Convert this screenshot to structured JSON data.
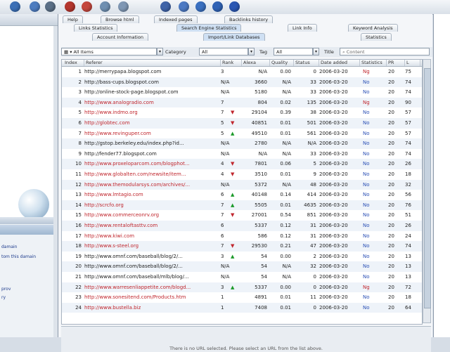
{
  "toolbar": {
    "buttons": [
      {
        "name": "refresh-icon",
        "color": "#3b6fb6"
      },
      {
        "name": "user-icon",
        "color": "#4d7cc0"
      },
      {
        "name": "settings-icon",
        "color": "#5b6f86"
      },
      {
        "name": "stop-icon",
        "color": "#b4362e"
      },
      {
        "name": "record-icon",
        "color": "#c4473d"
      },
      {
        "name": "globe-icon",
        "color": "#6f8fb1"
      },
      {
        "name": "page-icon",
        "color": "#7f97b4"
      },
      {
        "name": "clock-icon",
        "color": "#3f63a8"
      },
      {
        "name": "edit-icon",
        "color": "#4c79c3"
      },
      {
        "name": "check-icon",
        "color": "#3a70c0"
      },
      {
        "name": "save-icon",
        "color": "#2f62b5"
      },
      {
        "name": "help-icon",
        "color": "#2b57b3"
      }
    ]
  },
  "tabs_row1": [
    "Help",
    "Browse html",
    "Indexed pages",
    "Backlinks history"
  ],
  "tabs_row2": [
    "Links Statistics",
    "Search Engine Statistics",
    "Link Info",
    "Keyword Analysis"
  ],
  "tabs_row3": [
    "Account Information",
    "Import/Link Databases",
    "Statistics"
  ],
  "filter": {
    "category_label": "Category",
    "tag_label": "Tag",
    "title_label": "Title",
    "all_items": "All Items",
    "category_value": "All",
    "tag_value": "All",
    "search_placeholder": "Content"
  },
  "columns": [
    "Index",
    "Referer",
    "Rank",
    "Alexa",
    "Quality",
    "Status",
    "Date added",
    "Statistics",
    "PR",
    "L"
  ],
  "rows": [
    {
      "index": "1",
      "url": "http://merrypapa.blogspot.com",
      "color": "black",
      "rank": "3",
      "trend": "",
      "alexa": "N/A",
      "quality": "0.00",
      "status": "0",
      "date": "2006-03-20",
      "stat": "Ng",
      "pr": "20",
      "l": "75"
    },
    {
      "index": "2",
      "url": "http://bass-cups.blogspot.com",
      "color": "black",
      "rank": "N/A",
      "trend": "",
      "alexa": "3660",
      "quality": "N/A",
      "status": "33",
      "date": "2006-03-20",
      "stat": "No",
      "pr": "20",
      "l": "74"
    },
    {
      "index": "3",
      "url": "http://online-stock-page.blogspot.com",
      "color": "black",
      "rank": "N/A",
      "trend": "",
      "alexa": "5180",
      "quality": "N/A",
      "status": "33",
      "date": "2006-03-20",
      "stat": "No",
      "pr": "20",
      "l": "74"
    },
    {
      "index": "4",
      "url": "http://www.analogradio.com",
      "color": "red",
      "rank": "7",
      "trend": "",
      "alexa": "804",
      "quality": "0.02",
      "status": "135",
      "date": "2006-03-20",
      "stat": "Ng",
      "pr": "20",
      "l": "90"
    },
    {
      "index": "5",
      "url": "http://www.indmo.org",
      "color": "red",
      "rank": "7",
      "trend": "dn",
      "alexa": "29104",
      "quality": "0.39",
      "status": "38",
      "date": "2006-03-20",
      "stat": "No",
      "pr": "20",
      "l": "57"
    },
    {
      "index": "6",
      "url": "http://globtec.com",
      "color": "red",
      "rank": "5",
      "trend": "dn",
      "alexa": "40851",
      "quality": "0.01",
      "status": "501",
      "date": "2006-03-20",
      "stat": "No",
      "pr": "20",
      "l": "57"
    },
    {
      "index": "7",
      "url": "http://www.revinguper.com",
      "color": "red",
      "rank": "5",
      "trend": "up",
      "alexa": "49510",
      "quality": "0.01",
      "status": "561",
      "date": "2006-03-20",
      "stat": "No",
      "pr": "20",
      "l": "57"
    },
    {
      "index": "8",
      "url": "http://gstop.berkeley.edu/index.php?id...",
      "color": "black",
      "rank": "N/A",
      "trend": "",
      "alexa": "2780",
      "quality": "N/A",
      "status": "N/A",
      "date": "2006-03-20",
      "stat": "No",
      "pr": "20",
      "l": "74"
    },
    {
      "index": "9",
      "url": "http://fender77.blogspot.com",
      "color": "black",
      "rank": "N/A",
      "trend": "",
      "alexa": "N/A",
      "quality": "N/A",
      "status": "33",
      "date": "2006-03-20",
      "stat": "No",
      "pr": "20",
      "l": "74"
    },
    {
      "index": "10",
      "url": "http://www.proxeloparcom.com/blogphot...",
      "color": "red",
      "rank": "4",
      "trend": "dn",
      "alexa": "7801",
      "quality": "0.06",
      "status": "5",
      "date": "2006-03-20",
      "stat": "No",
      "pr": "20",
      "l": "26"
    },
    {
      "index": "11",
      "url": "http://www.globalten.com/newsite/item...",
      "color": "red",
      "rank": "4",
      "trend": "dn",
      "alexa": "3510",
      "quality": "0.01",
      "status": "9",
      "date": "2006-03-20",
      "stat": "No",
      "pr": "20",
      "l": "18"
    },
    {
      "index": "12",
      "url": "http://www.themodularsys.com/archives/...",
      "color": "red",
      "rank": "N/A",
      "trend": "",
      "alexa": "5372",
      "quality": "N/A",
      "status": "48",
      "date": "2006-03-20",
      "stat": "No",
      "pr": "20",
      "l": "32"
    },
    {
      "index": "13",
      "url": "http://www.lmtagio.com",
      "color": "red",
      "rank": "6",
      "trend": "up",
      "alexa": "40148",
      "quality": "0.14",
      "status": "414",
      "date": "2006-03-20",
      "stat": "No",
      "pr": "20",
      "l": "56"
    },
    {
      "index": "14",
      "url": "http://scrcfo.org",
      "color": "red",
      "rank": "7",
      "trend": "up",
      "alexa": "5505",
      "quality": "0.01",
      "status": "4635",
      "date": "2006-03-20",
      "stat": "No",
      "pr": "20",
      "l": "76"
    },
    {
      "index": "15",
      "url": "http://www.commerceonrv.org",
      "color": "red",
      "rank": "7",
      "trend": "dn",
      "alexa": "27001",
      "quality": "0.54",
      "status": "851",
      "date": "2006-03-20",
      "stat": "No",
      "pr": "20",
      "l": "51"
    },
    {
      "index": "16",
      "url": "http://www.rentaloftasttv.com",
      "color": "red",
      "rank": "6",
      "trend": "",
      "alexa": "5337",
      "quality": "0.12",
      "status": "31",
      "date": "2006-03-20",
      "stat": "No",
      "pr": "20",
      "l": "26"
    },
    {
      "index": "17",
      "url": "http://www.kiwi.com",
      "color": "red",
      "rank": "6",
      "trend": "",
      "alexa": "586",
      "quality": "0.12",
      "status": "31",
      "date": "2006-03-20",
      "stat": "No",
      "pr": "20",
      "l": "24"
    },
    {
      "index": "18",
      "url": "http://www.s-steel.org",
      "color": "red",
      "rank": "7",
      "trend": "dn",
      "alexa": "29530",
      "quality": "0.21",
      "status": "47",
      "date": "2006-03-20",
      "stat": "No",
      "pr": "20",
      "l": "74"
    },
    {
      "index": "19",
      "url": "http://www.omnf.com/baseball/blog/2/...",
      "color": "black",
      "rank": "3",
      "trend": "up",
      "alexa": "54",
      "quality": "0.00",
      "status": "2",
      "date": "2006-03-20",
      "stat": "No",
      "pr": "20",
      "l": "13"
    },
    {
      "index": "20",
      "url": "http://www.omnf.com/baseball/blog/2/...",
      "color": "black",
      "rank": "N/A",
      "trend": "",
      "alexa": "54",
      "quality": "N/A",
      "status": "32",
      "date": "2006-03-20",
      "stat": "No",
      "pr": "20",
      "l": "13"
    },
    {
      "index": "21",
      "url": "http://www.omnf.com/baseball/mlb/blog/...",
      "color": "black",
      "rank": "N/A",
      "trend": "",
      "alexa": "54",
      "quality": "N/A",
      "status": "0",
      "date": "2006-03-20",
      "stat": "No",
      "pr": "20",
      "l": "13"
    },
    {
      "index": "22",
      "url": "http://www.warresenliappetite.com/blogd...",
      "color": "red",
      "rank": "3",
      "trend": "up",
      "alexa": "5337",
      "quality": "0.00",
      "status": "0",
      "date": "2006-03-20",
      "stat": "Ng",
      "pr": "20",
      "l": "72"
    },
    {
      "index": "23",
      "url": "http://www.sonesitend.com/Products.htm",
      "color": "red",
      "rank": "1",
      "trend": "",
      "alexa": "4891",
      "quality": "0.01",
      "status": "11",
      "date": "2006-03-20",
      "stat": "No",
      "pr": "20",
      "l": "18"
    },
    {
      "index": "24",
      "url": "http://www.bustella.biz",
      "color": "red",
      "rank": "1",
      "trend": "",
      "alexa": "7408",
      "quality": "0.01",
      "status": "0",
      "date": "2006-03-20",
      "stat": "No",
      "pr": "20",
      "l": "64"
    }
  ],
  "bottom_message": "There is no URL selected. Please select an URL from the list above.",
  "left_panel": {
    "items": [
      "damain",
      "tom this damain",
      "prov",
      "ry"
    ]
  }
}
